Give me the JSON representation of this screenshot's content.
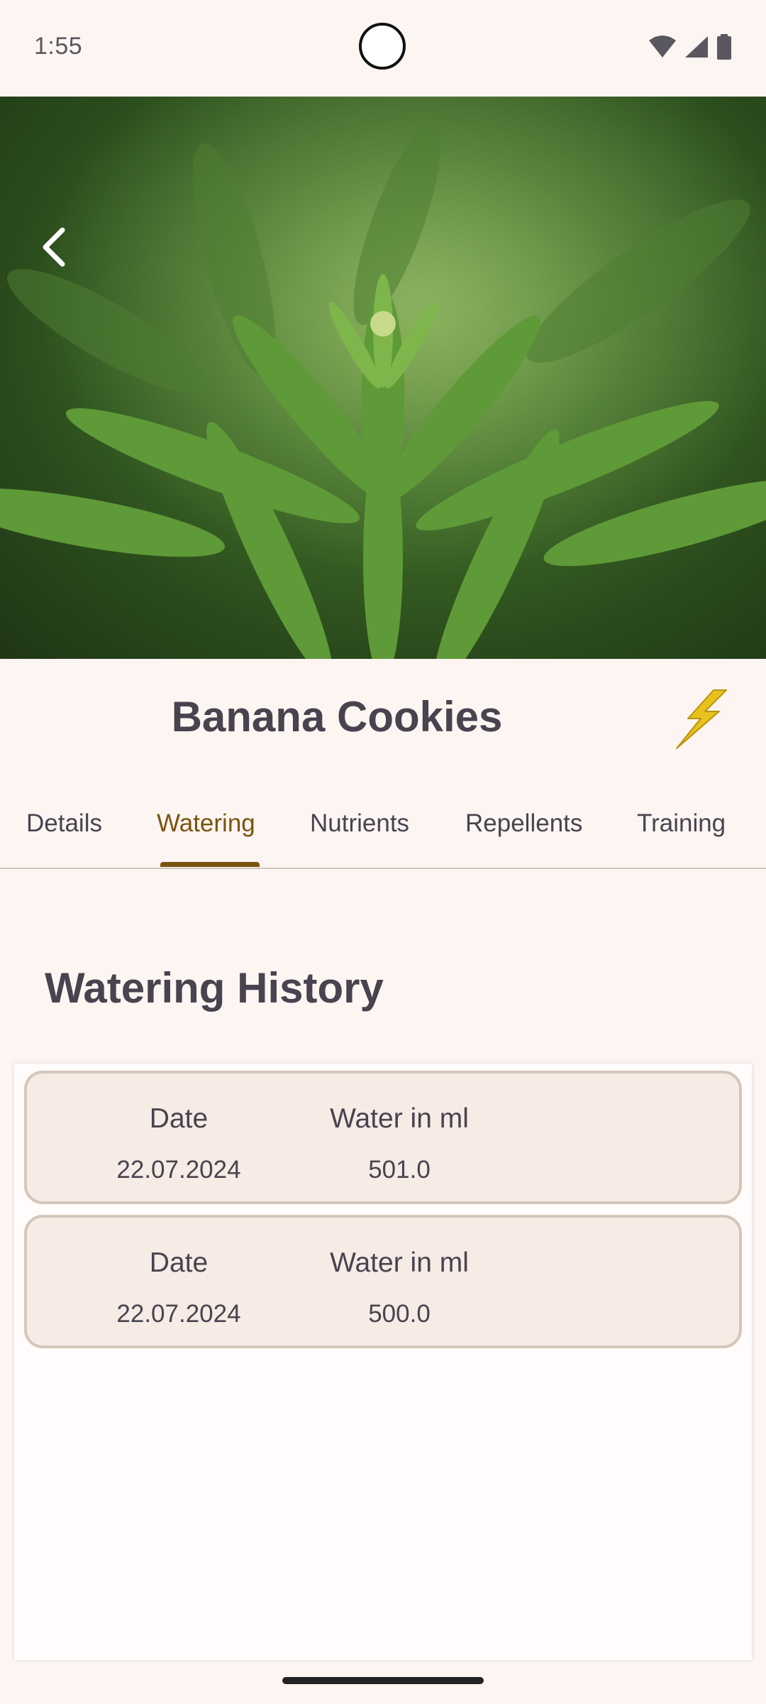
{
  "status_bar": {
    "time": "1:55",
    "icons": [
      "wifi-icon",
      "signal-icon",
      "battery-icon"
    ]
  },
  "hero": {
    "image": "plant-photo",
    "back_icon": "chevron-left-icon"
  },
  "header": {
    "title": "Banana Cookies",
    "action_icon": "lightning-bolt-icon"
  },
  "tabs": {
    "items": [
      {
        "label": "Details",
        "active": false
      },
      {
        "label": "Watering",
        "active": true
      },
      {
        "label": "Nutrients",
        "active": false
      },
      {
        "label": "Repellents",
        "active": false
      },
      {
        "label": "Training",
        "active": false
      }
    ]
  },
  "main": {
    "section_title": "Watering History",
    "columns": {
      "date": "Date",
      "water": "Water in ml"
    },
    "entries": [
      {
        "date": "22.07.2024",
        "water": "501.0"
      },
      {
        "date": "22.07.2024",
        "water": "500.0"
      }
    ]
  },
  "colors": {
    "background": "#fdf5f2",
    "accent": "#7a5410",
    "card": "#f6ebe5",
    "card_border": "#d6c6b9",
    "bolt": "#e7c21f"
  }
}
